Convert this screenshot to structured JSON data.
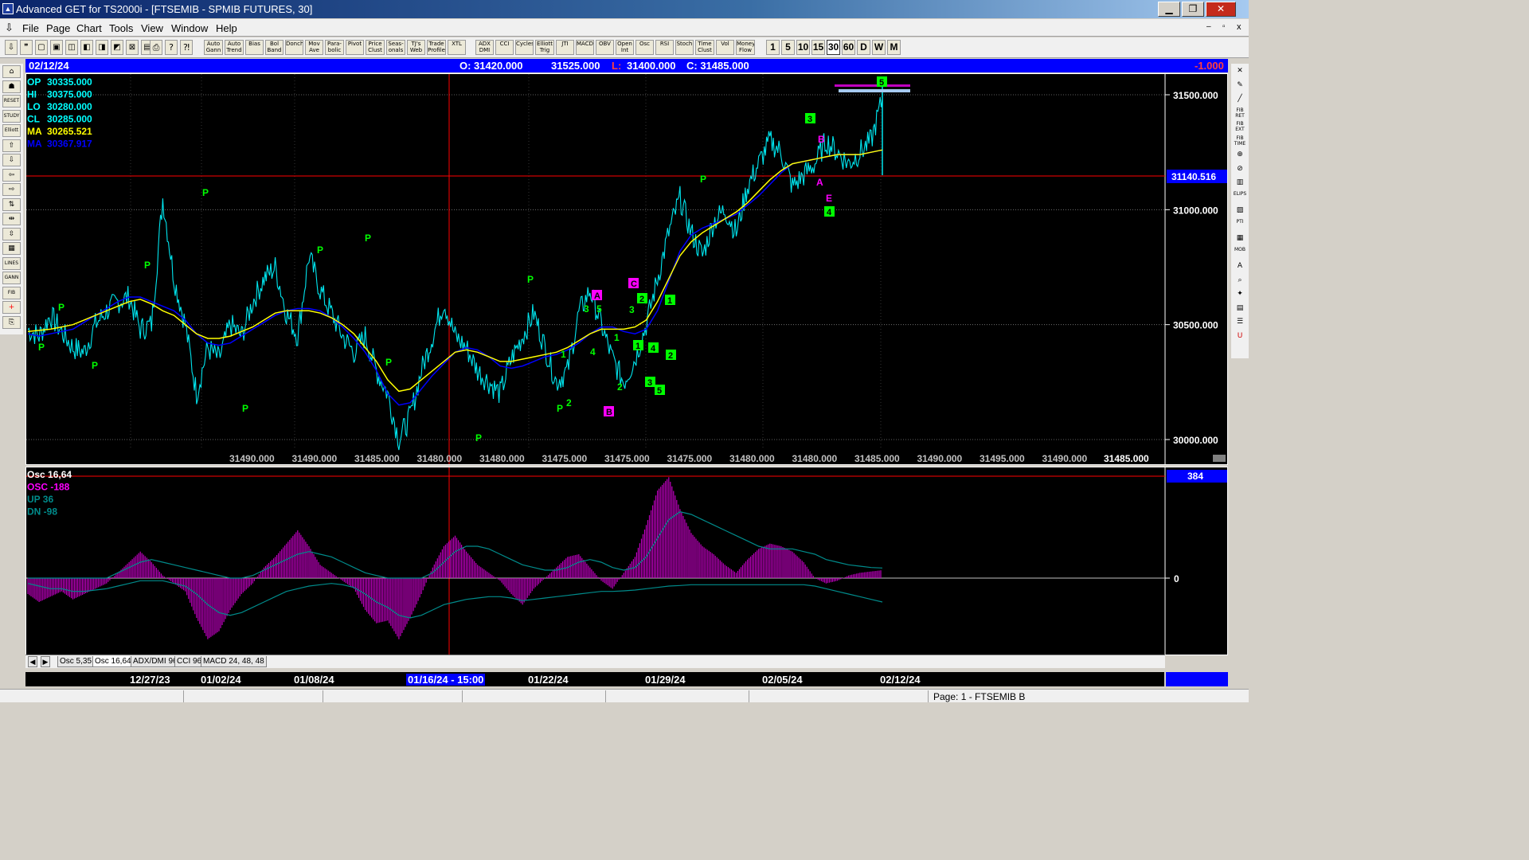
{
  "window": {
    "title": "Advanced GET for TS2000i - [FTSEMIB - SPMIB FUTURES, 30]",
    "app_icon": "advanced-get-icon",
    "min_glyph": "▁",
    "max_glyph": "❐",
    "close_glyph": "✕"
  },
  "menu": [
    "File",
    "Page",
    "Chart",
    "Tools",
    "View",
    "Window",
    "Help"
  ],
  "toolbar": {
    "indicators": [
      "Auto Gann",
      "Auto Trend",
      "Bias",
      "Bol Band",
      "Donch",
      "Mov Ave",
      "Para-bolic",
      "Pivot",
      "Price Clust",
      "Seas-onals",
      "TJ's Web",
      "Trade Profile",
      "XTL",
      "ADX DMI",
      "CCI",
      "Cycles",
      "Elliott Trig",
      "JTI",
      "MACD",
      "OBV",
      "Open Int",
      "Osc",
      "RSI",
      "Stoch",
      "Time Clust",
      "Vol",
      "Money Flow"
    ],
    "periods": [
      "1",
      "5",
      "10",
      "15",
      "30",
      "60",
      "D",
      "W",
      "M"
    ],
    "active_period": "30"
  },
  "left_tools": [
    "Elliott",
    "RESET",
    "STUDY",
    "LINES",
    "GANN",
    "FIB"
  ],
  "right_tools": [
    "FIB RET",
    "FIB EXT",
    "FIB TIME",
    "ELIPS",
    "PTI",
    "MOB",
    "A"
  ],
  "infobar": {
    "date": "02/12/24",
    "open": "O: 31420.000",
    "high": "31525.000",
    "low_label": "L:",
    "low": "31400.000",
    "close": "C: 31485.000",
    "change": "-1.000"
  },
  "price_legend": [
    {
      "label": "OP",
      "value": "30335.000",
      "color": "#00ffff"
    },
    {
      "label": "HI",
      "value": "30375.000",
      "color": "#00ffff"
    },
    {
      "label": "LO",
      "value": "30280.000",
      "color": "#00ffff"
    },
    {
      "label": "CL",
      "value": "30285.000",
      "color": "#00ffff"
    },
    {
      "label": "MA",
      "value": "30265.521",
      "color": "#ffff00"
    },
    {
      "label": "MA",
      "value": "30367.917",
      "color": "#0000ff"
    }
  ],
  "price_axis": {
    "ticks": [
      "31500.000",
      "31000.000",
      "30500.000",
      "30000.000"
    ],
    "cursor_value": "31140.516"
  },
  "price_strip": [
    "31490.000",
    "31490.000",
    "31485.000",
    "31480.000",
    "31480.000",
    "31475.000",
    "31475.000",
    "31475.000",
    "31480.000",
    "31480.000",
    "31485.000",
    "31490.000",
    "31495.000",
    "31490.000"
  ],
  "price_strip_last": "31485.000",
  "osc_legend": [
    {
      "label": "Osc 16,64",
      "color": "#ffffff"
    },
    {
      "label": "OSC -188",
      "color": "#ff00ff"
    },
    {
      "label": "UP   36",
      "color": "#008b8b"
    },
    {
      "label": "DN   -98",
      "color": "#008b8b"
    }
  ],
  "osc_axis": {
    "value_box": "384",
    "zero": "0"
  },
  "osc_tabs": [
    "Osc 5,35",
    "Osc 16,64",
    "ADX/DMI 96",
    "CCI 96",
    "MACD 24, 48, 48"
  ],
  "osc_active_tab": "Osc 16,64",
  "dates": [
    "12/27/23",
    "01/02/24",
    "01/08/24",
    "01/16/24 - 15:00",
    "01/22/24",
    "01/29/24",
    "02/05/24",
    "02/12/24"
  ],
  "dates_cursor": "01/16/24 - 15:00",
  "status": "Page: 1 - FTSEMIB B",
  "colors": {
    "price": "#00e5ee",
    "ma_fast": "#ffff00",
    "ma_slow": "#0000ff",
    "pivot": "#00ff00",
    "wave_box": "#00ff00",
    "abc_box": "#ff00ff",
    "osc": "#c000c0",
    "band": "#008b8b",
    "cursor_line": "#ff0000"
  },
  "chart_data": [
    {
      "type": "line",
      "title": "FTSEMIB - SPMIB FUTURES, 30",
      "x_dates": [
        "12/27/23",
        "01/02/24",
        "01/08/24",
        "01/16/24",
        "01/22/24",
        "01/29/24",
        "02/05/24",
        "02/12/24"
      ],
      "ylim": [
        29990,
        31560
      ],
      "series": [
        {
          "name": "Price",
          "values": [
            30480,
            30450,
            30540,
            30470,
            30400,
            30380,
            30500,
            30560,
            30600,
            30620,
            30480,
            30500,
            31050,
            30700,
            30500,
            30200,
            30400,
            30350,
            30500,
            30450,
            30600,
            30700,
            30750,
            30550,
            30450,
            30800,
            30650,
            30550,
            30450,
            30380,
            30450,
            30300,
            30200,
            30000,
            30100,
            30300,
            30450,
            30600,
            30450,
            30400,
            30300,
            30250,
            30200,
            30350,
            30450,
            30550,
            30400,
            30250,
            30300,
            30550,
            30650,
            30500,
            30350,
            30250,
            30350,
            30500,
            30700,
            30900,
            31050,
            30900,
            30800,
            30950,
            31000,
            30900,
            31100,
            31200,
            31300,
            31250,
            31100,
            31150,
            31200,
            31300,
            31250,
            31200,
            31250,
            31300,
            31480
          ]
        },
        {
          "name": "MA",
          "values": [
            30470,
            30475,
            30480,
            30490,
            30500,
            30520,
            30540,
            30560,
            30580,
            30600,
            30610,
            30590,
            30560,
            30540,
            30500,
            30460,
            30440,
            30440,
            30450,
            30470,
            30490,
            30520,
            30550,
            30560,
            30560,
            30560,
            30550,
            30530,
            30500,
            30460,
            30400,
            30340,
            30260,
            30210,
            30220,
            30260,
            30300,
            30340,
            30380,
            30390,
            30380,
            30360,
            30340,
            30340,
            30350,
            30360,
            30370,
            30380,
            30400,
            30430,
            30460,
            30480,
            30480,
            30480,
            30490,
            30520,
            30600,
            30700,
            30800,
            30860,
            30900,
            30930,
            30960,
            30990,
            31030,
            31080,
            31130,
            31170,
            31200,
            31210,
            31220,
            31230,
            31240,
            31240,
            31240,
            31250,
            31260
          ]
        },
        {
          "name": "MA",
          "values": [
            30460,
            30450,
            30460,
            30470,
            30480,
            30510,
            30540,
            30570,
            30600,
            30620,
            30620,
            30600,
            30580,
            30560,
            30520,
            30460,
            30420,
            30410,
            30420,
            30450,
            30480,
            30510,
            30540,
            30560,
            30570,
            30570,
            30560,
            30530,
            30490,
            30440,
            30380,
            30300,
            30200,
            30150,
            30160,
            30220,
            30280,
            30330,
            30380,
            30400,
            30390,
            30360,
            30320,
            30310,
            30320,
            30340,
            30360,
            30370,
            30390,
            30420,
            30460,
            30490,
            30490,
            30470,
            30460,
            30480,
            30560,
            30690,
            30820,
            30890,
            30920,
            30940,
            30960,
            30980,
            31020,
            31060,
            31110,
            31160,
            31200,
            31210,
            31220,
            31230,
            31240,
            31240,
            31240,
            31250,
            31260
          ]
        }
      ],
      "annotations": [
        "P",
        "3",
        "5",
        "A",
        "B",
        "C",
        "1",
        "2",
        "4",
        "E"
      ]
    },
    {
      "type": "bar",
      "title": "Osc 16,64",
      "ylim": [
        -260,
        420
      ],
      "series": [
        {
          "name": "OSC",
          "values": [
            -60,
            -90,
            -70,
            -50,
            -80,
            -60,
            -40,
            -20,
            20,
            60,
            100,
            60,
            10,
            -20,
            -50,
            -150,
            -230,
            -200,
            -120,
            -60,
            -20,
            40,
            80,
            130,
            180,
            120,
            50,
            20,
            -10,
            -40,
            -120,
            -170,
            -160,
            -230,
            -150,
            -60,
            40,
            120,
            160,
            100,
            50,
            20,
            -10,
            -60,
            -100,
            -40,
            0,
            40,
            80,
            90,
            40,
            -10,
            -40,
            20,
            80,
            200,
            330,
            380,
            260,
            170,
            120,
            90,
            50,
            20,
            70,
            110,
            130,
            120,
            100,
            60,
            0,
            -20,
            -10,
            10,
            20,
            25,
            30
          ]
        },
        {
          "name": "UP",
          "values": [
            0,
            0,
            0,
            0,
            0,
            0,
            0,
            0,
            20,
            40,
            60,
            70,
            60,
            50,
            40,
            30,
            20,
            10,
            0,
            0,
            10,
            30,
            50,
            70,
            90,
            100,
            90,
            80,
            60,
            40,
            20,
            10,
            0,
            0,
            0,
            0,
            20,
            60,
            100,
            120,
            120,
            110,
            90,
            70,
            50,
            40,
            30,
            30,
            40,
            60,
            70,
            60,
            40,
            30,
            40,
            80,
            150,
            220,
            250,
            240,
            220,
            200,
            180,
            160,
            140,
            120,
            110,
            110,
            110,
            100,
            90,
            70,
            60,
            50,
            45,
            40,
            38
          ]
        },
        {
          "name": "DN",
          "values": [
            -20,
            -30,
            -40,
            -40,
            -50,
            -50,
            -45,
            -40,
            -30,
            -20,
            -10,
            -10,
            -10,
            -20,
            -30,
            -60,
            -100,
            -130,
            -140,
            -130,
            -110,
            -90,
            -70,
            -50,
            -40,
            -30,
            -25,
            -20,
            -25,
            -35,
            -60,
            -90,
            -110,
            -140,
            -150,
            -140,
            -120,
            -100,
            -90,
            -80,
            -75,
            -70,
            -70,
            -75,
            -85,
            -80,
            -75,
            -70,
            -65,
            -60,
            -55,
            -50,
            -50,
            -48,
            -45,
            -40,
            -35,
            -30,
            -28,
            -25,
            -25,
            -25,
            -25,
            -25,
            -25,
            -25,
            -25,
            -25,
            -25,
            -25,
            -30,
            -40,
            -50,
            -60,
            -70,
            -80,
            -90
          ]
        }
      ]
    }
  ]
}
